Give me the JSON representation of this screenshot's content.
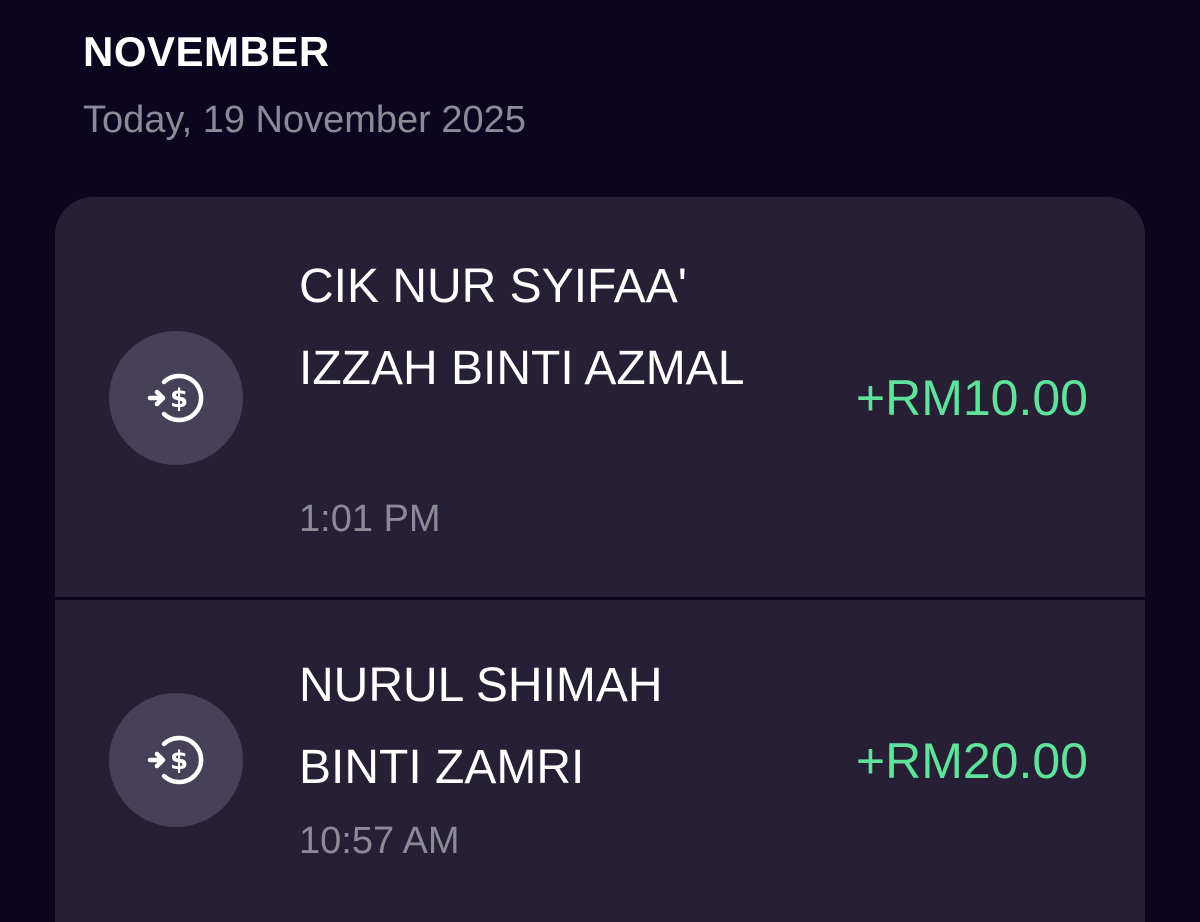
{
  "header": {
    "month": "NOVEMBER",
    "date": "Today, 19 November 2025"
  },
  "transactions": [
    {
      "name": "CIK NUR SYIFAA' IZZAH BINTI AZMAL",
      "time": "1:01 PM",
      "amount": "+RM10.00",
      "icon": "money-in-icon"
    },
    {
      "name": "NURUL SHIMAH BINTI ZAMRI",
      "time": "10:57 AM",
      "amount": "+RM20.00",
      "icon": "money-in-icon"
    }
  ],
  "colors": {
    "background": "#0c0520",
    "card": "#261f35",
    "icon_circle": "#474059",
    "amount_positive": "#5fe39b",
    "muted_text": "#8c8a96"
  }
}
